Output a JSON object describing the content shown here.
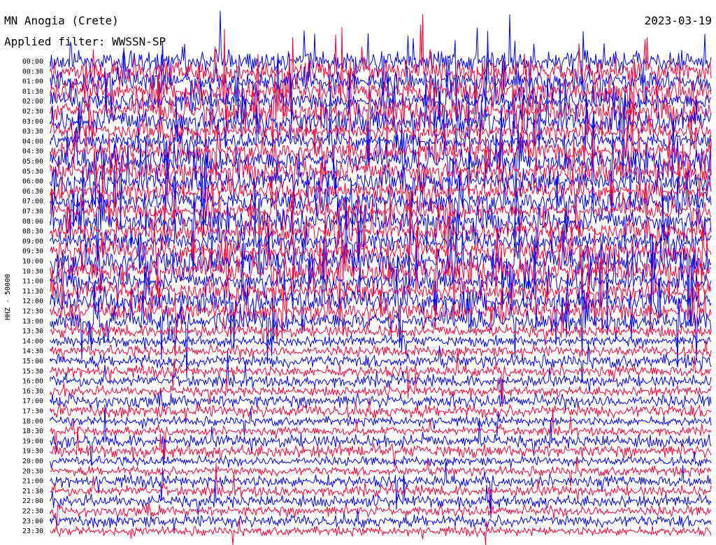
{
  "header": {
    "station": "MN Anogia (Crete)",
    "date": "2023-03-19",
    "filter": "Applied filter: WWSSN-SP"
  },
  "chart_data": {
    "type": "line",
    "title": "MN Anogia (Crete)",
    "date": "2023-03-19",
    "filter": "WWSSN-SP",
    "ylabel": "HHZ - 50000",
    "rows": [
      "00:00",
      "00:30",
      "01:00",
      "01:30",
      "02:00",
      "02:30",
      "03:00",
      "03:30",
      "04:00",
      "04:30",
      "05:00",
      "05:30",
      "06:00",
      "06:30",
      "07:00",
      "07:30",
      "08:00",
      "08:30",
      "09:00",
      "09:30",
      "10:00",
      "10:30",
      "11:00",
      "11:30",
      "12:00",
      "12:30",
      "13:00",
      "13:30",
      "14:00",
      "14:30",
      "15:00",
      "15:30",
      "16:00",
      "16:30",
      "17:00",
      "17:30",
      "18:00",
      "18:30",
      "19:00",
      "19:30",
      "20:00",
      "20:30",
      "21:00",
      "21:30",
      "22:00",
      "22:30",
      "23:00",
      "23:30"
    ],
    "row_colors": [
      "#0000ff",
      "#ff0033"
    ],
    "grid": false,
    "legend": "none"
  },
  "colors": {
    "blue": "#0000ff",
    "red": "#ff0033"
  }
}
